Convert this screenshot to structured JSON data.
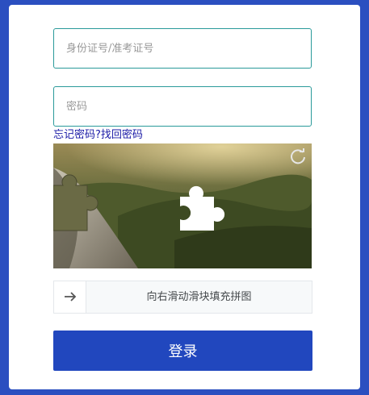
{
  "form": {
    "username_placeholder": "身份证号/准考证号",
    "password_placeholder": "密码",
    "forgot_link": "忘记密码?找回密码",
    "login_button": "登录"
  },
  "captcha": {
    "refresh_icon": "refresh-icon",
    "slider_text": "向右滑动滑块填充拼图",
    "slider_icon": "arrow-right-icon"
  },
  "colors": {
    "page_background": "#2b4fc0",
    "field_border": "#2a9a9a",
    "link": "#1a1aa6",
    "login_button": "#2147be"
  }
}
